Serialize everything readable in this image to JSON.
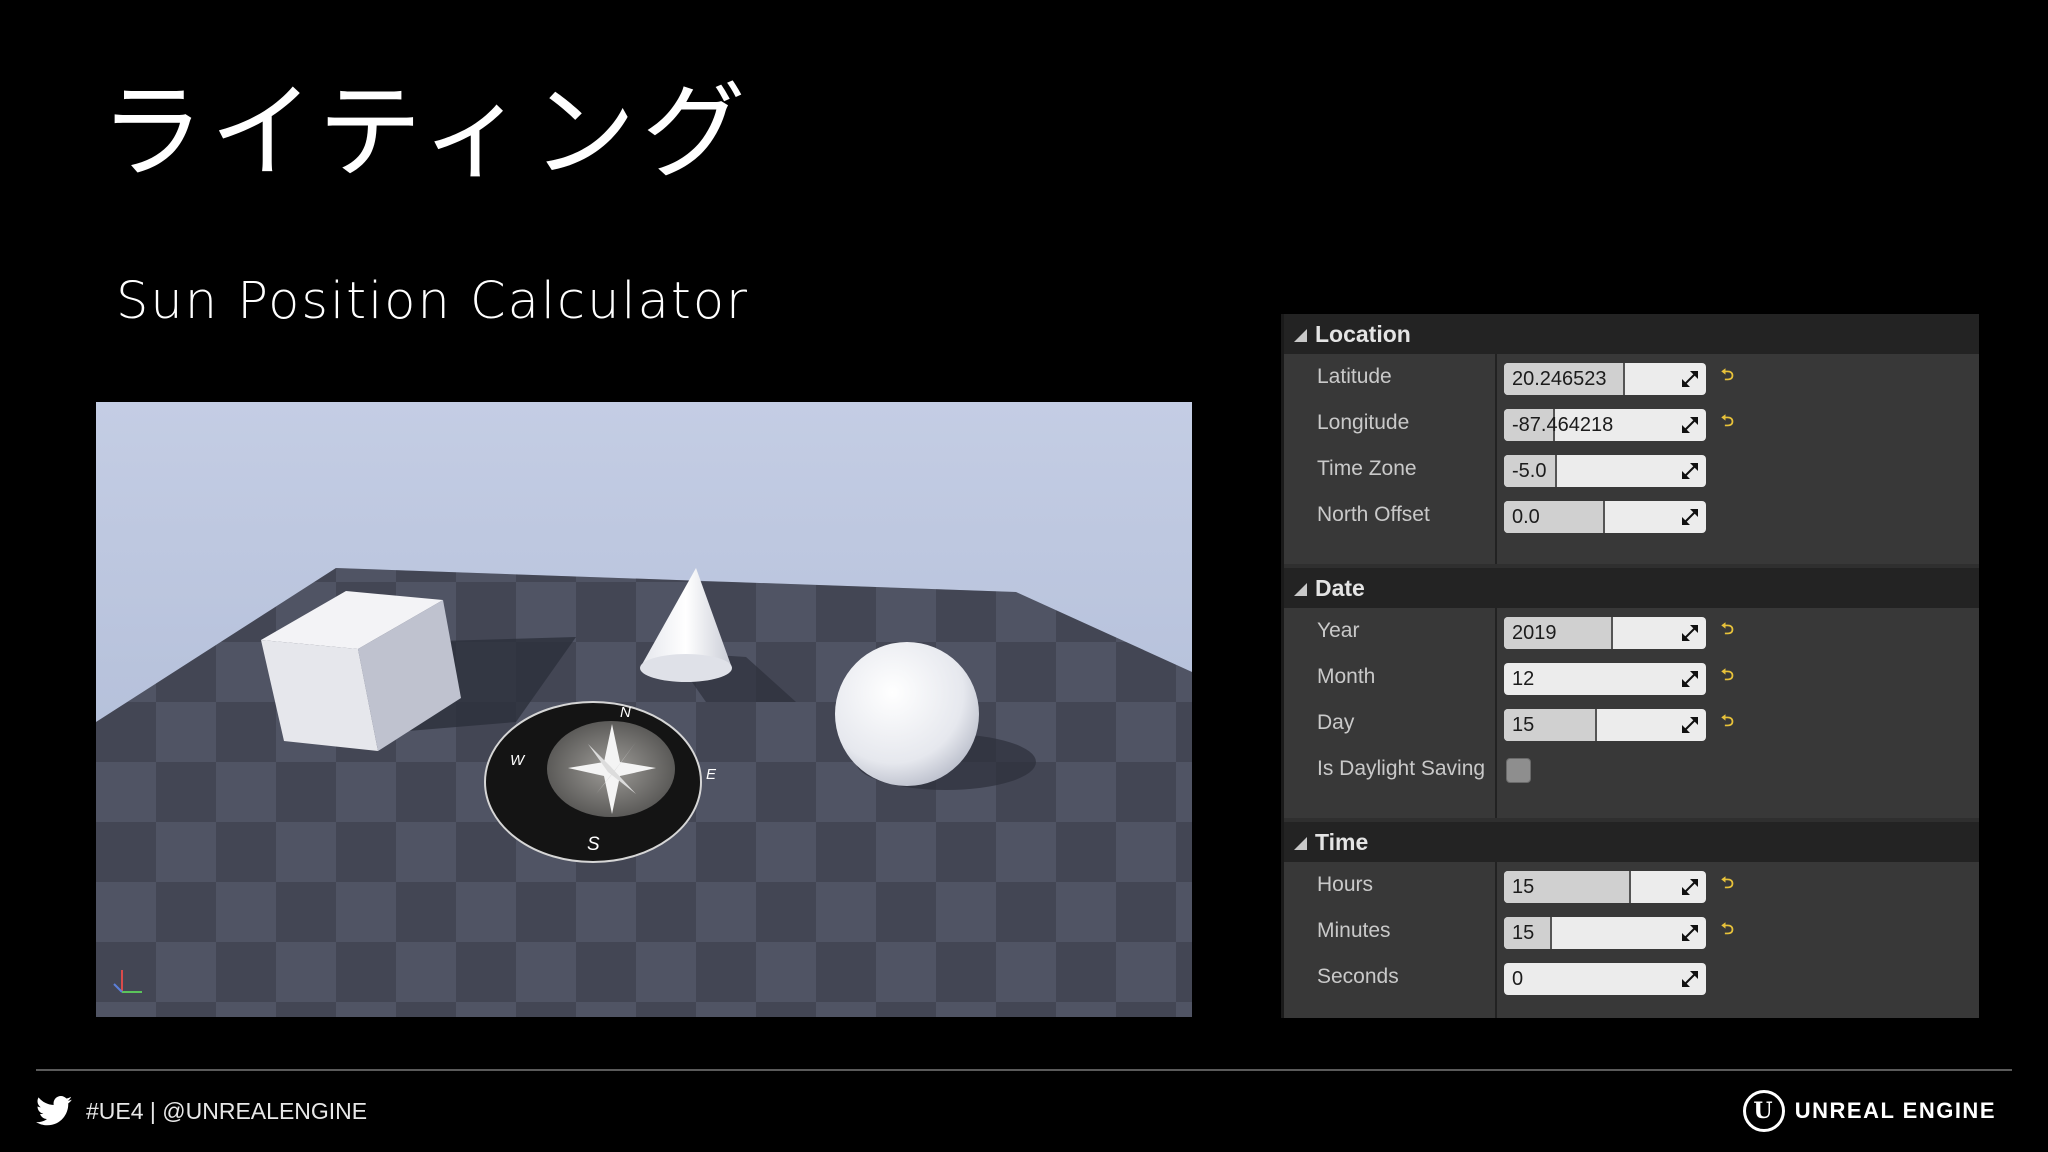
{
  "slide": {
    "title": "ライティング",
    "subtitle": "Sun Position Calculator"
  },
  "viewport": {
    "compass": {
      "north": "N",
      "south": "S",
      "east": "E",
      "west": "W"
    }
  },
  "panel": {
    "location": {
      "header": "Location",
      "rows": {
        "latitude": {
          "label": "Latitude",
          "value": "20.246523",
          "fill": 0.6
        },
        "longitude": {
          "label": "Longitude",
          "value": "-87.464218",
          "fill": 0.25
        },
        "time_zone": {
          "label": "Time Zone",
          "value": "-5.0",
          "fill": 0.26
        },
        "north_offset": {
          "label": "North Offset",
          "value": "0.0",
          "fill": 0.5
        }
      }
    },
    "date": {
      "header": "Date",
      "rows": {
        "year": {
          "label": "Year",
          "value": "2019",
          "fill": 0.54
        },
        "month": {
          "label": "Month",
          "value": "12",
          "fill": 0.0
        },
        "day": {
          "label": "Day",
          "value": "15",
          "fill": 0.46
        },
        "daylight": {
          "label": "Is Daylight Saving",
          "checked": false
        }
      }
    },
    "time": {
      "header": "Time",
      "rows": {
        "hours": {
          "label": "Hours",
          "value": "15",
          "fill": 0.63
        },
        "minutes": {
          "label": "Minutes",
          "value": "15",
          "fill": 0.24
        },
        "seconds": {
          "label": "Seconds",
          "value": "0",
          "fill": 0.0
        }
      }
    }
  },
  "footer": {
    "social": "#UE4 | @UNREALENGINE",
    "brand": "UNREAL ENGINE",
    "logo_letter": "U"
  },
  "colors": {
    "reset_arrow": "#e8c23a",
    "panel_bg": "#383838",
    "header_bg": "#232323"
  }
}
